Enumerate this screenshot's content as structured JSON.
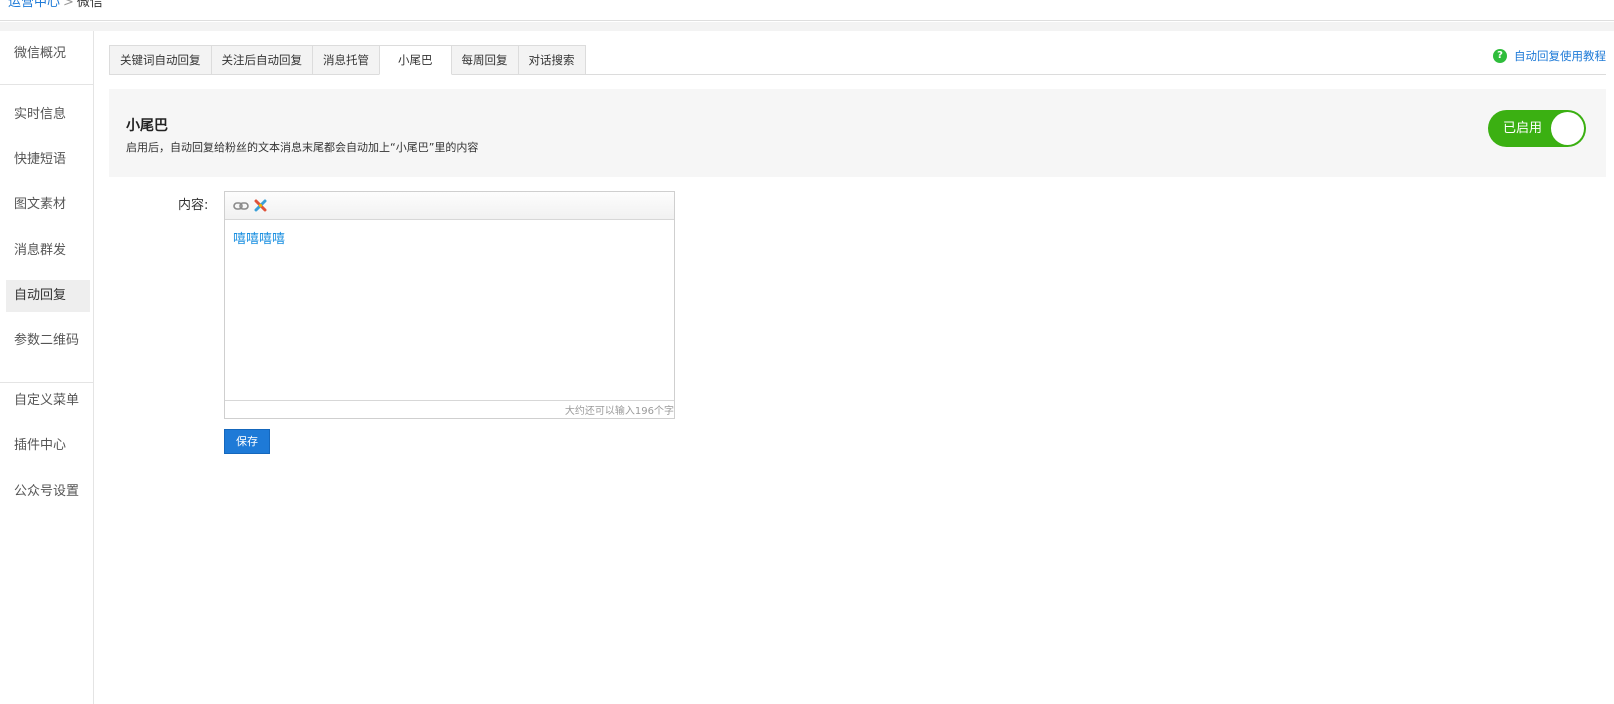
{
  "breadcrumb": {
    "parent": "运营中心",
    "separator": ">",
    "current": "微信"
  },
  "sidebar": {
    "items": [
      {
        "label": "微信概况",
        "active": false
      },
      {
        "label": "实时信息",
        "active": false
      },
      {
        "label": "快捷短语",
        "active": false
      },
      {
        "label": "图文素材",
        "active": false
      },
      {
        "label": "消息群发",
        "active": false
      },
      {
        "label": "自动回复",
        "active": true
      },
      {
        "label": "参数二维码",
        "active": false
      },
      {
        "label": "自定义菜单",
        "active": false
      },
      {
        "label": "插件中心",
        "active": false
      },
      {
        "label": "公众号设置",
        "active": false
      }
    ]
  },
  "tabs": [
    {
      "label": "关键词自动回复",
      "active": false
    },
    {
      "label": "关注后自动回复",
      "active": false
    },
    {
      "label": "消息托管",
      "active": false
    },
    {
      "label": "小尾巴",
      "active": true
    },
    {
      "label": "每周回复",
      "active": false
    },
    {
      "label": "对话搜索",
      "active": false
    }
  ],
  "help": {
    "icon": "question-circle-icon",
    "label": "自动回复使用教程"
  },
  "panel": {
    "title": "小尾巴",
    "description": "启用后，自动回复给粉丝的文本消息末尾都会自动加上“小尾巴”里的内容",
    "toggle": {
      "label": "已启用",
      "enabled": true
    }
  },
  "form": {
    "content_label": "内容:",
    "toolbar": [
      "link-icon",
      "unlink-icon"
    ],
    "content_value": "嘻嘻嘻嘻",
    "char_count": "大约还可以输入196个字",
    "save_label": "保存"
  },
  "colors": {
    "accent": "#1e7ad7",
    "toggle_on": "#3bb012",
    "help_icon": "#2fbd3b",
    "content_text": "#1a8fe0"
  }
}
